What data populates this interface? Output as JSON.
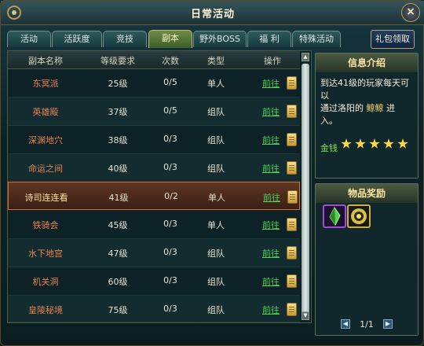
{
  "window": {
    "title": "日常活动"
  },
  "tabs": [
    {
      "label": "活动"
    },
    {
      "label": "活跃度"
    },
    {
      "label": "竞技"
    },
    {
      "label": "副本"
    },
    {
      "label": "野外BOSS"
    },
    {
      "label": "福  利"
    },
    {
      "label": "特殊活动"
    }
  ],
  "active_tab": "副本",
  "gift_button": "礼包领取",
  "table": {
    "headers": [
      "副本名称",
      "等级要求",
      "次数",
      "类型",
      "操作"
    ],
    "rows": [
      {
        "name": "东冥派",
        "level": "25级",
        "count": "0/5",
        "type": "单人",
        "action": "前往"
      },
      {
        "name": "英雄殿",
        "level": "37级",
        "count": "0/5",
        "type": "组队",
        "action": "前往"
      },
      {
        "name": "深渊地穴",
        "level": "38级",
        "count": "0/3",
        "type": "组队",
        "action": "前往"
      },
      {
        "name": "命运之间",
        "level": "40级",
        "count": "0/3",
        "type": "组队",
        "action": "前往"
      },
      {
        "name": "诗司连连看",
        "level": "41级",
        "count": "0/2",
        "type": "单人",
        "action": "前往"
      },
      {
        "name": "铁骑会",
        "level": "45级",
        "count": "0/3",
        "type": "单人",
        "action": "前往"
      },
      {
        "name": "水下地宫",
        "level": "47级",
        "count": "0/3",
        "type": "组队",
        "action": "前往"
      },
      {
        "name": "机关洞",
        "level": "60级",
        "count": "0/3",
        "type": "组队",
        "action": "前往"
      },
      {
        "name": "皇陵秘境",
        "level": "75级",
        "count": "0/3",
        "type": "组队",
        "action": "前往"
      }
    ],
    "selected_row": 4
  },
  "info_panel": {
    "title": "信息介绍",
    "text_line1": "到达41级的玩家每天可以",
    "text_line2": "通过洛阳的",
    "npc": "鲸鲸",
    "text_line3": "进",
    "text_line4": "入。",
    "reward_label": "金钱",
    "stars": 5
  },
  "reward_panel": {
    "title": "物品奖励",
    "items": [
      "green-crystal-icon",
      "gold-orb-icon"
    ],
    "page": "1/1"
  },
  "colors": {
    "dungeon_name": "#e8824e",
    "action_link": "#4fd15a",
    "selected_border": "#d7683a",
    "npc_highlight": "#ffd86a",
    "star": "#ffd94a"
  }
}
